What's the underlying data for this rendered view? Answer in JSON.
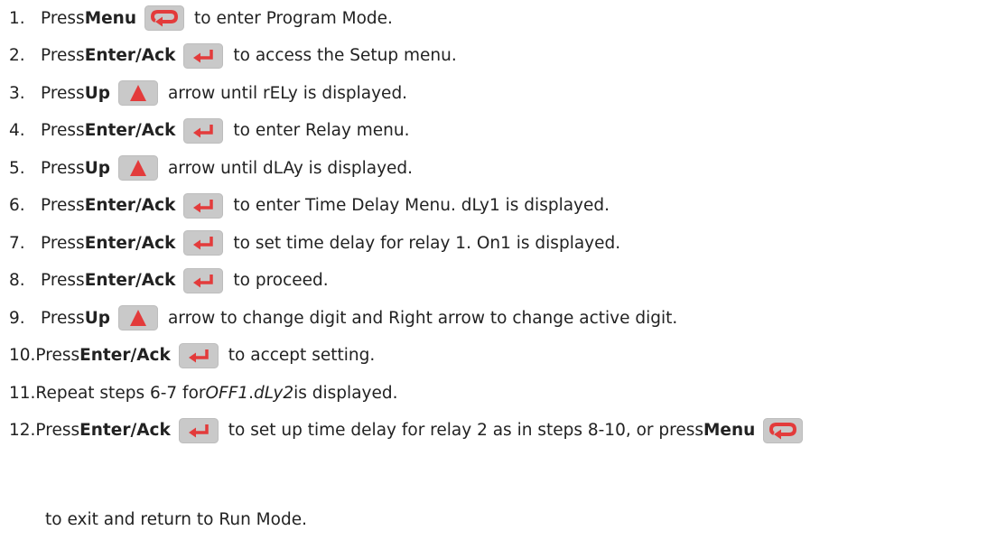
{
  "keys": {
    "menu_icon": "menu-loop-arrow",
    "enter_icon": "enter-return-arrow",
    "up_icon": "up-triangle-arrow",
    "key_fill": "#c9c9c9",
    "glyph_color": "#e33b3b"
  },
  "steps": [
    {
      "num": "1.",
      "pre": "Press ",
      "kw": "Menu",
      "key": "menu",
      "post": " to enter Program Mode."
    },
    {
      "num": "2.",
      "pre": "Press ",
      "kw": "Enter/Ack",
      "key": "enter",
      "post": " to access the Setup menu."
    },
    {
      "num": "3.",
      "pre": "Press ",
      "kw": "Up",
      "key": "up",
      "post": " arrow until rELy is displayed."
    },
    {
      "num": "4.",
      "pre": "Press ",
      "kw": "Enter/Ack",
      "key": "enter",
      "post": " to enter Relay menu."
    },
    {
      "num": "5.",
      "pre": "Press ",
      "kw": "Up",
      "key": "up",
      "post": " arrow until dLAy is displayed."
    },
    {
      "num": "6.",
      "pre": "Press ",
      "kw": "Enter/Ack",
      "key": "enter",
      "post": " to enter Time Delay Menu. dLy1 is displayed."
    },
    {
      "num": "7.",
      "pre": "Press ",
      "kw": "Enter/Ack",
      "key": "enter",
      "post": " to set time delay for relay 1. On1 is displayed."
    },
    {
      "num": "8.",
      "pre": "Press ",
      "kw": "Enter/Ack",
      "key": "enter",
      "post": " to proceed."
    },
    {
      "num": "9.",
      "pre": "Press ",
      "kw": "Up",
      "key": "up",
      "post": " arrow to change digit and Right arrow to change active digit."
    },
    {
      "num": "10.",
      "pre": "Press ",
      "kw": "Enter/Ack",
      "key": "enter",
      "post": " to accept setting."
    }
  ],
  "step11": {
    "num": "11.",
    "a": "Repeat steps 6-7 for ",
    "b": "OFF1",
    "c": ". ",
    "d": "dLy2",
    "e": " is displayed."
  },
  "step12": {
    "num": "12.",
    "pre": "Press ",
    "kw": "Enter/Ack",
    "mid": " to set up time delay for relay 2 as in steps 8-10, or press ",
    "kw2": "Menu",
    "cont": "to exit and return to Run Mode."
  }
}
